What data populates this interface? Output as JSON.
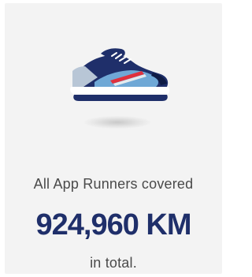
{
  "card": {
    "caption_top": "All App Runners covered",
    "distance_value": "924,960 KM",
    "caption_bottom": "in total."
  },
  "icons": {
    "shoe": "running-shoe-icon"
  },
  "colors": {
    "card_background": "#f3f3f3",
    "distance_text": "#1f2f6a",
    "caption_text": "#4a4a4a",
    "shoe_upper": "#1f2f6a",
    "shoe_panel": "#6fa8d6",
    "shoe_stripe": "#e0313d",
    "shoe_toe": "#b8c6d6"
  }
}
